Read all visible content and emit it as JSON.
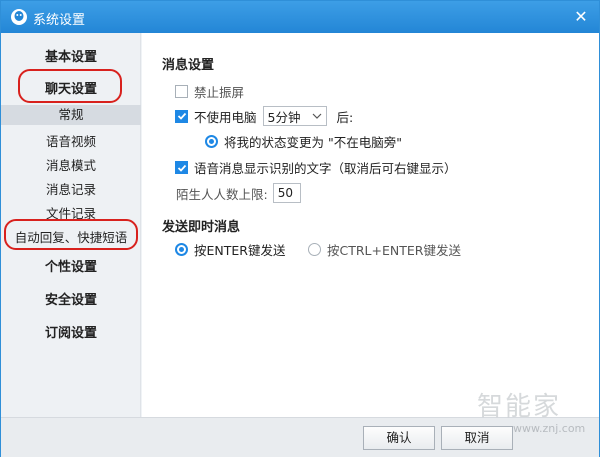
{
  "window": {
    "title": "系统设置",
    "close_glyph": "✕",
    "accent": "#2386d6"
  },
  "sidebar": {
    "main_items": [
      {
        "label": "基本设置"
      },
      {
        "label": "聊天设置"
      },
      {
        "label": "个性设置"
      },
      {
        "label": "安全设置"
      },
      {
        "label": "订阅设置"
      }
    ],
    "sub_items": [
      {
        "label": "常规",
        "active": true
      },
      {
        "label": "语音视频"
      },
      {
        "label": "消息模式"
      },
      {
        "label": "消息记录"
      },
      {
        "label": "文件记录"
      },
      {
        "label": "自动回复、快捷短语"
      }
    ]
  },
  "content": {
    "message_settings": {
      "title": "消息设置",
      "no_disturb": {
        "label": "禁止振屏",
        "checked": false
      },
      "away": {
        "label": "不使用电脑",
        "checked": true,
        "duration": "5分钟",
        "suffix": "后:"
      },
      "away_status": {
        "label": "将我的状态变更为 \"不在电脑旁\"",
        "selected": true
      },
      "voice_text": {
        "label": "语音消息显示识别的文字（取消后可右键显示）",
        "checked": true
      },
      "stranger_limit": {
        "label": "陌生人人数上限:",
        "value": "50"
      }
    },
    "send_settings": {
      "title": "发送即时消息",
      "option_enter": {
        "label": "按ENTER键发送",
        "selected": true
      },
      "option_ctrl_enter": {
        "label": "按CTRL+ENTER键发送",
        "selected": false
      }
    }
  },
  "footer": {
    "ok_label": "确认",
    "cancel_label": "取消"
  },
  "watermark": {
    "text": "智能家",
    "url": "www.znj.com"
  }
}
